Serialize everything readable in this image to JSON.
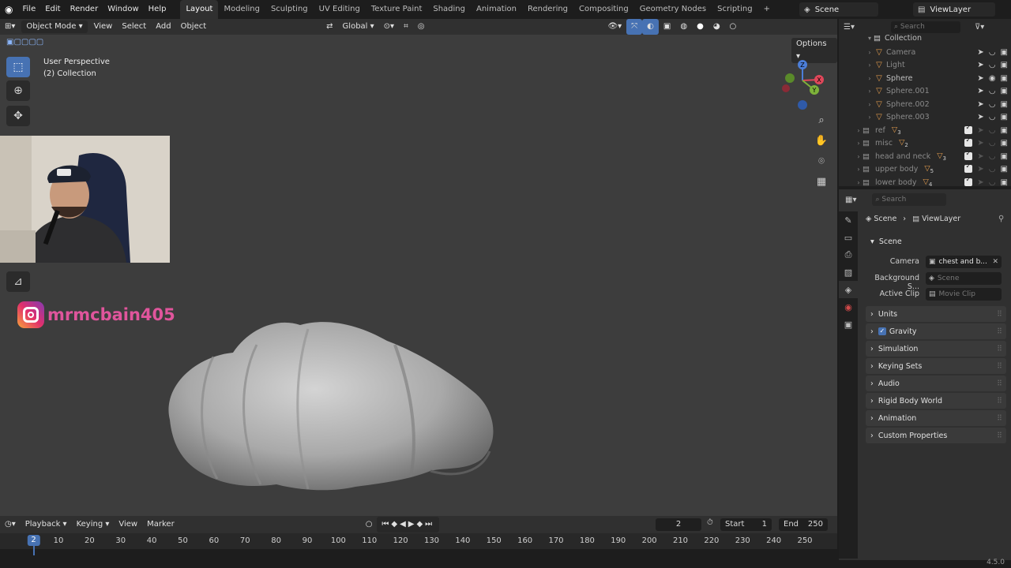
{
  "topbar": {
    "menus": [
      "File",
      "Edit",
      "Render",
      "Window",
      "Help"
    ],
    "workspaces": [
      "Layout",
      "Modeling",
      "Sculpting",
      "UV Editing",
      "Texture Paint",
      "Shading",
      "Animation",
      "Rendering",
      "Compositing",
      "Geometry Nodes",
      "Scripting"
    ],
    "active_workspace": "Layout",
    "add_tab": "+",
    "scene": "Scene",
    "view_layer": "ViewLayer"
  },
  "viewport": {
    "mode": "Object Mode",
    "menus": [
      "View",
      "Select",
      "Add",
      "Object"
    ],
    "transform_orientation": "Global",
    "options_label": "Options",
    "perspective_label": "User Perspective",
    "collection_label": "(2) Collection",
    "gizmo_axes": {
      "x": "X",
      "y": "Y",
      "z": "Z"
    },
    "mesh_color": "#b9b9b9"
  },
  "overlay": {
    "instagram_handle": "mrmcbain405"
  },
  "outliner": {
    "search_placeholder": "Search",
    "collection": "Collection",
    "objects": [
      {
        "name": "Camera",
        "dim": true
      },
      {
        "name": "Light",
        "dim": true
      },
      {
        "name": "Sphere",
        "dim": false
      },
      {
        "name": "Sphere.001",
        "dim": true
      },
      {
        "name": "Sphere.002",
        "dim": true
      },
      {
        "name": "Sphere.003",
        "dim": true
      }
    ],
    "collections": [
      {
        "name": "ref",
        "count": "3"
      },
      {
        "name": "misc",
        "count": "2"
      },
      {
        "name": "head and neck",
        "count": "3"
      },
      {
        "name": "upper body",
        "count": "5"
      },
      {
        "name": "lower body",
        "count": "4"
      }
    ]
  },
  "properties": {
    "search_placeholder": "Search",
    "breadcrumb": [
      "Scene",
      "ViewLayer"
    ],
    "scene_section": "Scene",
    "fields": [
      {
        "label": "Camera",
        "value": "chest and b...",
        "placeholder": false
      },
      {
        "label": "Background S...",
        "value": "Scene",
        "placeholder": true
      },
      {
        "label": "Active Clip",
        "value": "Movie Clip",
        "placeholder": true
      }
    ],
    "panels": [
      "Units",
      "Gravity",
      "Simulation",
      "Keying Sets",
      "Audio",
      "Rigid Body World",
      "Animation",
      "Custom Properties"
    ],
    "gravity_checked": true
  },
  "timeline": {
    "menus": [
      "Playback",
      "Keying",
      "View",
      "Marker"
    ],
    "current_frame": "2",
    "start_label": "Start",
    "start": "1",
    "end_label": "End",
    "end": "250",
    "ticks": [
      "2",
      "10",
      "20",
      "30",
      "40",
      "50",
      "60",
      "70",
      "80",
      "90",
      "100",
      "110",
      "120",
      "130",
      "140",
      "150",
      "160",
      "170",
      "180",
      "190",
      "200",
      "210",
      "220",
      "230",
      "240",
      "250"
    ]
  },
  "status": {
    "version": "4.5.0"
  }
}
